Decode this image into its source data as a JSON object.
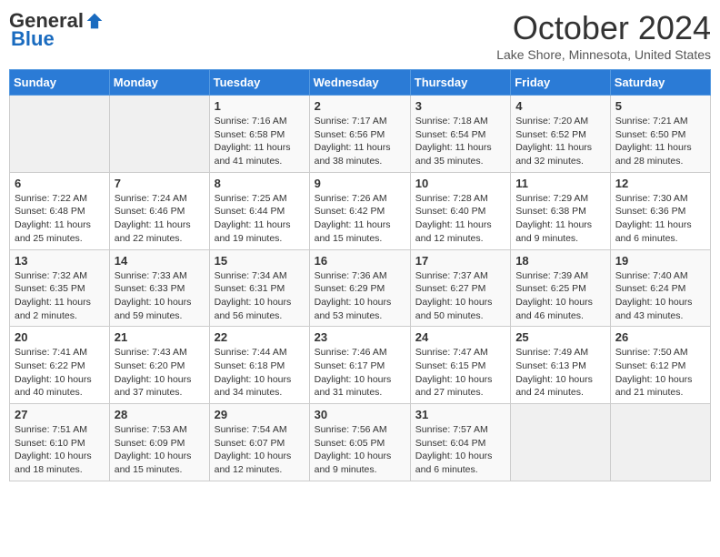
{
  "header": {
    "logo_general": "General",
    "logo_blue": "Blue",
    "month_title": "October 2024",
    "location": "Lake Shore, Minnesota, United States"
  },
  "days_of_week": [
    "Sunday",
    "Monday",
    "Tuesday",
    "Wednesday",
    "Thursday",
    "Friday",
    "Saturday"
  ],
  "weeks": [
    [
      {
        "day": "",
        "content": ""
      },
      {
        "day": "",
        "content": ""
      },
      {
        "day": "1",
        "content": "Sunrise: 7:16 AM\nSunset: 6:58 PM\nDaylight: 11 hours and 41 minutes."
      },
      {
        "day": "2",
        "content": "Sunrise: 7:17 AM\nSunset: 6:56 PM\nDaylight: 11 hours and 38 minutes."
      },
      {
        "day": "3",
        "content": "Sunrise: 7:18 AM\nSunset: 6:54 PM\nDaylight: 11 hours and 35 minutes."
      },
      {
        "day": "4",
        "content": "Sunrise: 7:20 AM\nSunset: 6:52 PM\nDaylight: 11 hours and 32 minutes."
      },
      {
        "day": "5",
        "content": "Sunrise: 7:21 AM\nSunset: 6:50 PM\nDaylight: 11 hours and 28 minutes."
      }
    ],
    [
      {
        "day": "6",
        "content": "Sunrise: 7:22 AM\nSunset: 6:48 PM\nDaylight: 11 hours and 25 minutes."
      },
      {
        "day": "7",
        "content": "Sunrise: 7:24 AM\nSunset: 6:46 PM\nDaylight: 11 hours and 22 minutes."
      },
      {
        "day": "8",
        "content": "Sunrise: 7:25 AM\nSunset: 6:44 PM\nDaylight: 11 hours and 19 minutes."
      },
      {
        "day": "9",
        "content": "Sunrise: 7:26 AM\nSunset: 6:42 PM\nDaylight: 11 hours and 15 minutes."
      },
      {
        "day": "10",
        "content": "Sunrise: 7:28 AM\nSunset: 6:40 PM\nDaylight: 11 hours and 12 minutes."
      },
      {
        "day": "11",
        "content": "Sunrise: 7:29 AM\nSunset: 6:38 PM\nDaylight: 11 hours and 9 minutes."
      },
      {
        "day": "12",
        "content": "Sunrise: 7:30 AM\nSunset: 6:36 PM\nDaylight: 11 hours and 6 minutes."
      }
    ],
    [
      {
        "day": "13",
        "content": "Sunrise: 7:32 AM\nSunset: 6:35 PM\nDaylight: 11 hours and 2 minutes."
      },
      {
        "day": "14",
        "content": "Sunrise: 7:33 AM\nSunset: 6:33 PM\nDaylight: 10 hours and 59 minutes."
      },
      {
        "day": "15",
        "content": "Sunrise: 7:34 AM\nSunset: 6:31 PM\nDaylight: 10 hours and 56 minutes."
      },
      {
        "day": "16",
        "content": "Sunrise: 7:36 AM\nSunset: 6:29 PM\nDaylight: 10 hours and 53 minutes."
      },
      {
        "day": "17",
        "content": "Sunrise: 7:37 AM\nSunset: 6:27 PM\nDaylight: 10 hours and 50 minutes."
      },
      {
        "day": "18",
        "content": "Sunrise: 7:39 AM\nSunset: 6:25 PM\nDaylight: 10 hours and 46 minutes."
      },
      {
        "day": "19",
        "content": "Sunrise: 7:40 AM\nSunset: 6:24 PM\nDaylight: 10 hours and 43 minutes."
      }
    ],
    [
      {
        "day": "20",
        "content": "Sunrise: 7:41 AM\nSunset: 6:22 PM\nDaylight: 10 hours and 40 minutes."
      },
      {
        "day": "21",
        "content": "Sunrise: 7:43 AM\nSunset: 6:20 PM\nDaylight: 10 hours and 37 minutes."
      },
      {
        "day": "22",
        "content": "Sunrise: 7:44 AM\nSunset: 6:18 PM\nDaylight: 10 hours and 34 minutes."
      },
      {
        "day": "23",
        "content": "Sunrise: 7:46 AM\nSunset: 6:17 PM\nDaylight: 10 hours and 31 minutes."
      },
      {
        "day": "24",
        "content": "Sunrise: 7:47 AM\nSunset: 6:15 PM\nDaylight: 10 hours and 27 minutes."
      },
      {
        "day": "25",
        "content": "Sunrise: 7:49 AM\nSunset: 6:13 PM\nDaylight: 10 hours and 24 minutes."
      },
      {
        "day": "26",
        "content": "Sunrise: 7:50 AM\nSunset: 6:12 PM\nDaylight: 10 hours and 21 minutes."
      }
    ],
    [
      {
        "day": "27",
        "content": "Sunrise: 7:51 AM\nSunset: 6:10 PM\nDaylight: 10 hours and 18 minutes."
      },
      {
        "day": "28",
        "content": "Sunrise: 7:53 AM\nSunset: 6:09 PM\nDaylight: 10 hours and 15 minutes."
      },
      {
        "day": "29",
        "content": "Sunrise: 7:54 AM\nSunset: 6:07 PM\nDaylight: 10 hours and 12 minutes."
      },
      {
        "day": "30",
        "content": "Sunrise: 7:56 AM\nSunset: 6:05 PM\nDaylight: 10 hours and 9 minutes."
      },
      {
        "day": "31",
        "content": "Sunrise: 7:57 AM\nSunset: 6:04 PM\nDaylight: 10 hours and 6 minutes."
      },
      {
        "day": "",
        "content": ""
      },
      {
        "day": "",
        "content": ""
      }
    ]
  ]
}
